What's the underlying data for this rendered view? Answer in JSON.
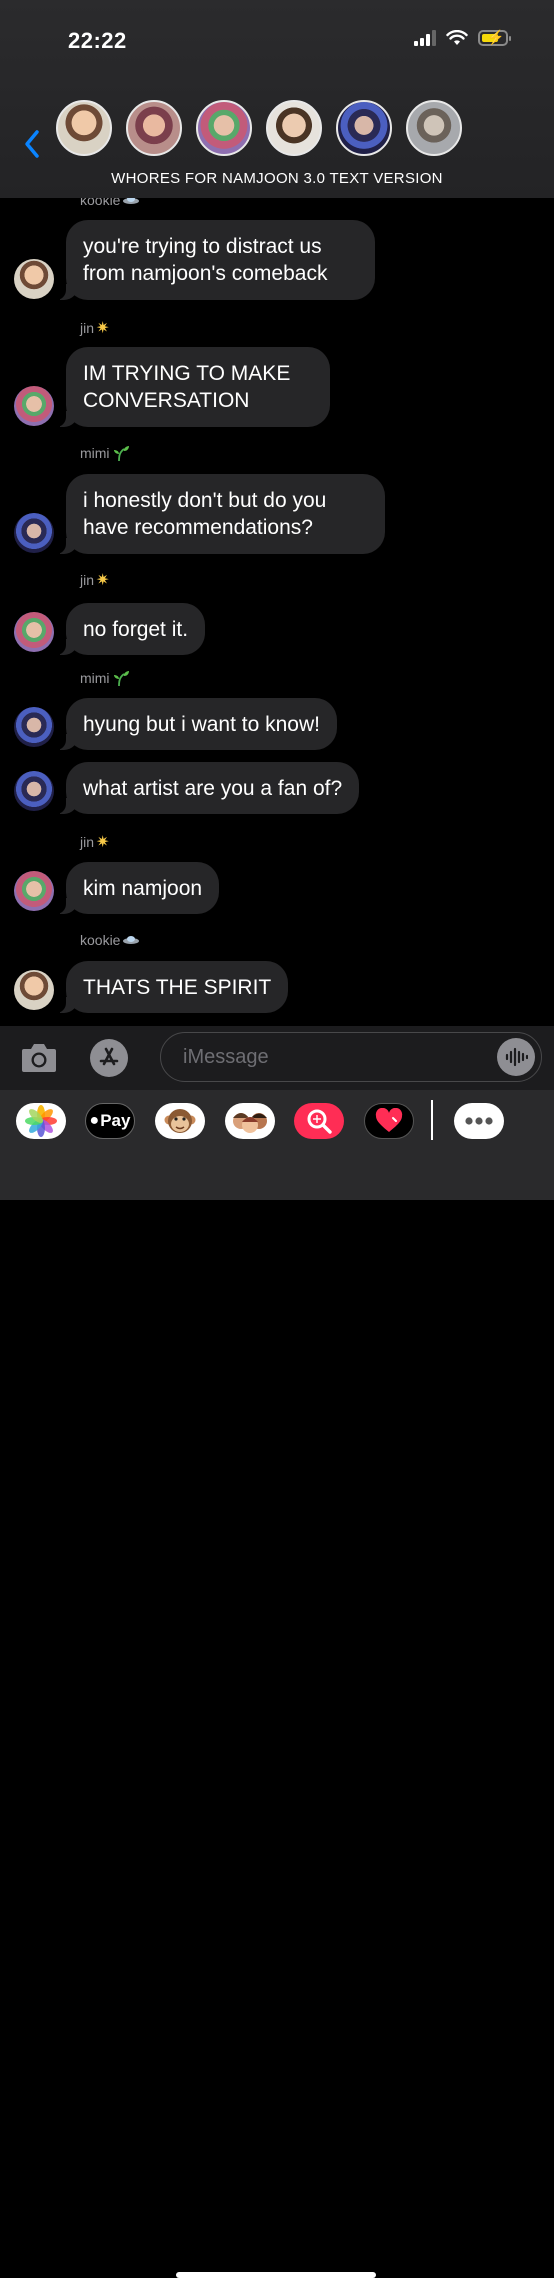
{
  "status_bar": {
    "time": "22:22"
  },
  "conversation": {
    "title": "WHORES FOR NAMJOON 3.0 TEXT VERSION"
  },
  "messages": [
    {
      "sender": "kookie",
      "text": "you're trying to distract us from namjoon's comeback"
    },
    {
      "sender": "jin",
      "text": "IM TRYING TO MAKE CONVERSATION"
    },
    {
      "sender": "mimi",
      "text": "i honestly don't but do you have recommendations?"
    },
    {
      "sender": "jin",
      "text": "no forget it."
    },
    {
      "sender": "mimi",
      "text": "hyung but i want to know!"
    },
    {
      "sender": "",
      "text": "what artist are you a fan of?"
    },
    {
      "sender": "jin",
      "text": "kim namjoon"
    },
    {
      "sender": "kookie",
      "text": "THATS THE SPIRIT"
    }
  ],
  "input": {
    "placeholder": "iMessage"
  },
  "app_drawer": {
    "apple_pay_label": "Pay"
  },
  "colors": {
    "header_bg": "#2b2b2d",
    "bubble_bg": "#262628",
    "accent_blue": "#0a84ff",
    "battery_yellow": "#f5d90a",
    "sender_text": "#9a9a9e"
  },
  "icons": [
    "chevron-left-icon",
    "signal-icon",
    "wifi-icon",
    "battery-icon",
    "camera-icon",
    "app-store-icon",
    "voice-memo-icon",
    "photos-icon",
    "apple-pay-icon",
    "memoji-icon",
    "search-images-icon",
    "heart-icon",
    "more-icon"
  ]
}
